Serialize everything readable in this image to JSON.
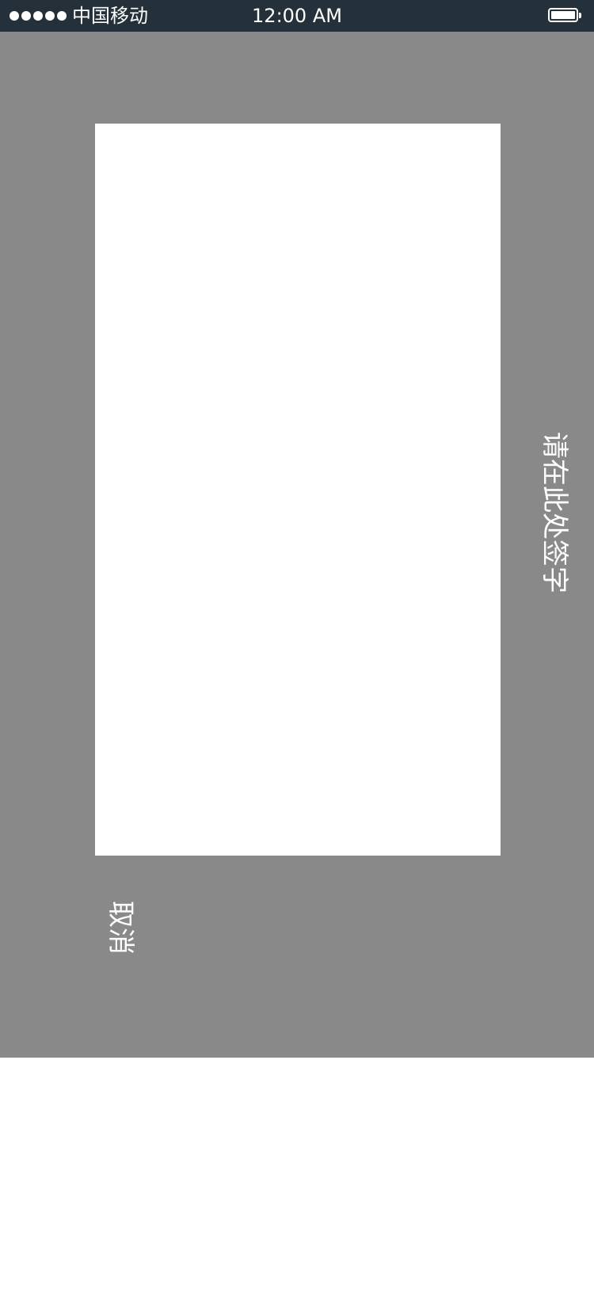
{
  "status_bar": {
    "signal_dots": 5,
    "carrier": "中国移动",
    "time": "12:00 AM",
    "battery_icon": "battery-full-icon"
  },
  "signature": {
    "hint": "请在此处签字",
    "cancel_label": "取消"
  },
  "colors": {
    "status_bar_bg": "#24313a",
    "overlay_bg": "#898989",
    "pad_bg": "#ffffff",
    "text": "#ffffff"
  }
}
